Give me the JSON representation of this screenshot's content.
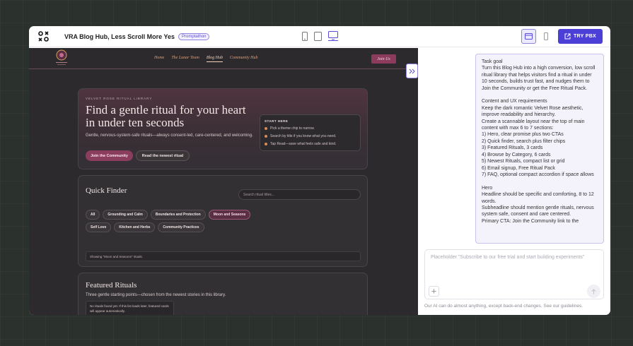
{
  "topbar": {
    "title": "VRA Blog Hub, Less Scroll More Yes",
    "badge": "Promptathon",
    "try_label": "TRY PBX",
    "colors": {
      "accent": "#4b3fd8"
    }
  },
  "site": {
    "nav": [
      "Home",
      "The Lunar Team",
      "Blog Hub",
      "Community Hub"
    ],
    "active_nav": "Blog Hub",
    "join_label": "Join Us",
    "hero": {
      "eyebrow": "VELVET ROSE RITUAL LIBRARY",
      "title": "Find a gentle ritual for your heart in under ten seconds",
      "subtitle": "Gentle, nervous-system-safe rituals—always consent-led, care-centered, and welcoming.",
      "cta_primary": "Join the Community",
      "cta_secondary": "Read the newest ritual",
      "start_title": "START HERE",
      "steps": [
        "Pick a theme chip to narrow.",
        "Search by title if you know what you need.",
        "Tap Read—save what feels safe and kind."
      ]
    },
    "finder": {
      "title": "Quick Finder",
      "search_placeholder": "Search ritual titles...",
      "chips": [
        "All",
        "Grounding and Calm",
        "Boundaries and Protection",
        "Moon and Seasons",
        "Self Love",
        "Kitchen and Herbs",
        "Community Practices"
      ],
      "active_chip": "Moon and Seasons",
      "showing": "Showing \"Moon and Seasons\" rituals."
    },
    "featured": {
      "title": "Featured Rituals",
      "subtitle": "Three gentle starting points—chosen from the newest stories in this library.",
      "empty": "No rituals found yet. If this list loads later, featured cards will appear automatically."
    }
  },
  "chat": {
    "message": "Task goal\nTurn this Blog Hub into a high conversion, low scroll ritual library that helps visitors find a ritual in under 10 seconds, builds trust fast, and nudges them to Join the Community or get the Free Ritual Pack.\n\nContent and UX requirements\nKeep the dark romantic Velvet Rose aesthetic, improve readability and hierarchy.\nCreate a scannable layout near the top of main content with max 6 to 7 sections:\n1) Hero, clear promise plus two CTAs\n2) Quick finder, search plus filter chips\n3) Featured Rituals, 3 cards\n4) Browse by Category, 6 cards\n5) Newest Rituals, compact list or grid\n6) Email signup, Free Ritual Pack\n7) FAQ, optional compact accordion if space allows\n\nHero\nHeadline should be specific and comforting, 8 to 12 words.\nSubheadline should mention gentle rituals, nervous system safe, consent and care centered.\nPrimary CTA: Join the Community link to the",
    "placeholder": "Placeholder \"Subscribe to our free trial and start building experiments\"",
    "footnote": "Our AI can do almost anything, except back-end changes. See our guidelines."
  }
}
